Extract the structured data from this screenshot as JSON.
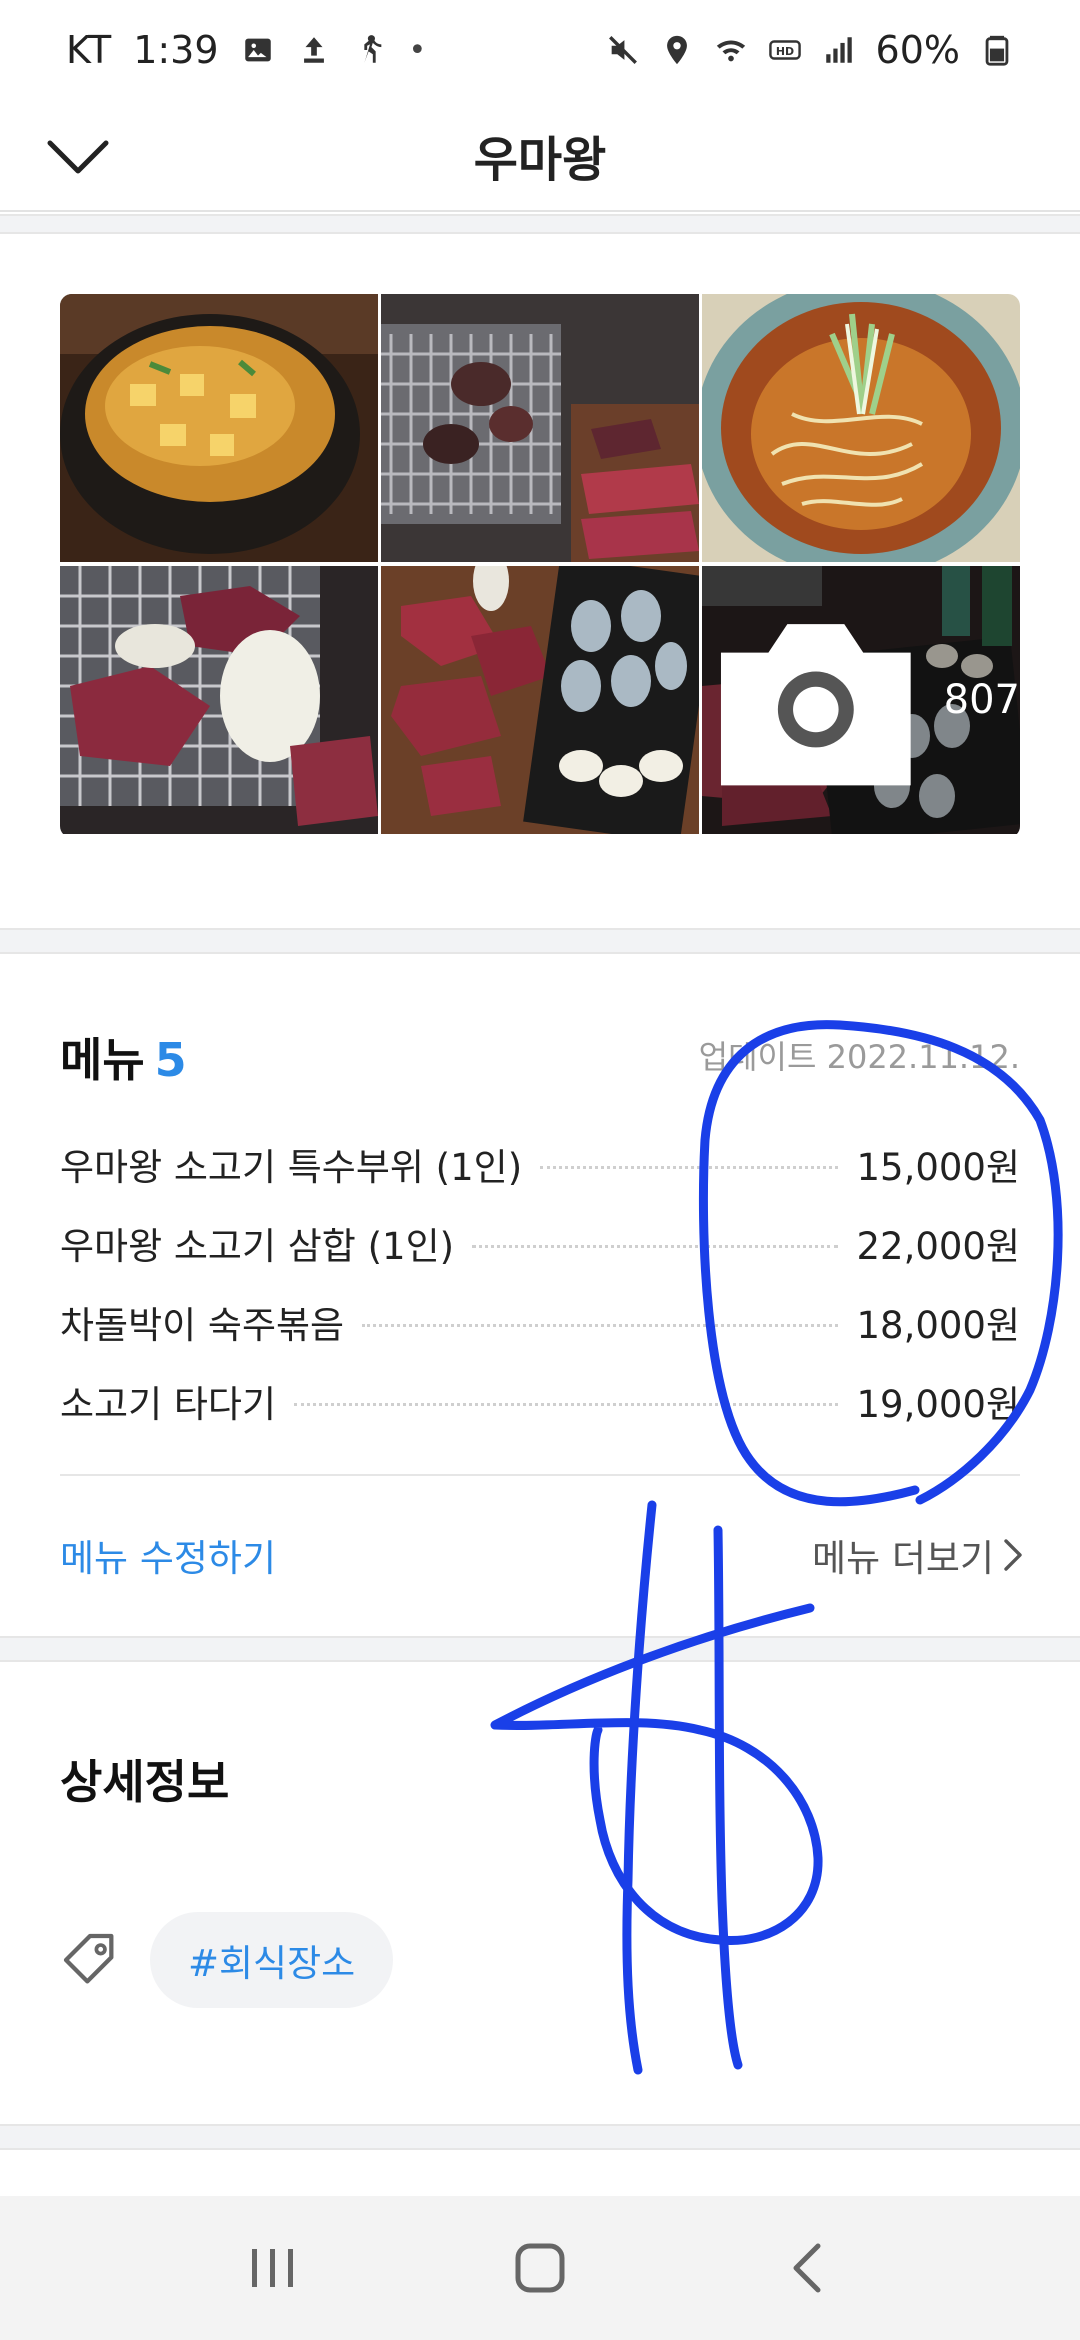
{
  "status_bar": {
    "carrier": "KT",
    "time": "1:39",
    "dot": "•",
    "battery": "60%"
  },
  "header": {
    "title": "우마왕"
  },
  "photos": {
    "count": "807"
  },
  "menu": {
    "title": "메뉴",
    "count": "5",
    "updated": "업데이트 2022.11.12.",
    "items": [
      {
        "name": "우마왕 소고기 특수부위 (1인)",
        "price": "15,000원"
      },
      {
        "name": "우마왕 소고기 삼합 (1인)",
        "price": "22,000원"
      },
      {
        "name": "차돌박이 숙주볶음",
        "price": "18,000원"
      },
      {
        "name": "소고기 타다기",
        "price": "19,000원"
      }
    ],
    "edit_label": "메뉴 수정하기",
    "more_label": "메뉴 더보기"
  },
  "details": {
    "title": "상세정보",
    "tag": "#회식장소"
  },
  "colors": {
    "accent": "#2c8ae6",
    "ink": "#1a3fe8"
  }
}
